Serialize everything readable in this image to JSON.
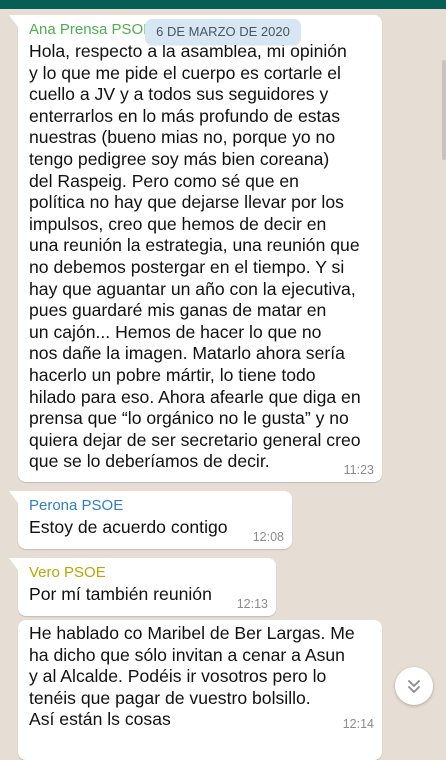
{
  "messages": [
    {
      "sender": "Ana Prensa PSOE",
      "sender_color": "#4caf50",
      "lines": [
        "Hola, respecto a la asamblea, mi opinión",
        "y lo que me pide el cuerpo es cortarle el",
        "cuello a JV y a todos sus seguidores y",
        "enterrarlos en lo más profundo de estas",
        "nuestras (bueno mias no, porque yo no",
        "tengo pedigree soy más bien coreana)",
        "del Raspeig. Pero como sé que en",
        "política no hay que dejarse llevar por los",
        "impulsos, creo que hemos de decir en",
        "una reunión la estrategia, una reunión que",
        "no debemos postergar en el tiempo. Y si",
        "hay que aguantar un año con la ejecutiva,",
        "pues guardaré mis ganas de matar en",
        "un cajón... Hemos de hacer lo que no",
        "nos dañe la imagen. Matarlo ahora sería",
        "hacerlo un pobre mártir, lo tiene todo",
        "hilado para eso. Ahora afearle que diga en",
        "prensa que “lo orgánico no le gusta” y no",
        "quiera dejar de ser secretario general creo",
        "que se lo deberíamos de decir."
      ],
      "time": "11:23"
    },
    {
      "sender": "Perona PSOE",
      "sender_color": "#2f7fc1",
      "lines": [
        "Estoy de acuerdo contigo"
      ],
      "time": "12:08"
    },
    {
      "sender": "Vero PSOE",
      "sender_color": "#b5a800",
      "lines": [
        "Por mí también reunión"
      ],
      "time": "12:13"
    },
    {
      "sender": "",
      "lines": [
        "He hablado co Maribel de Ber Largas. Me",
        "ha dicho que sólo invitan a cenar a Asun",
        "y al Alcalde. Podéis ir vosotros pero lo",
        "tenéis que pagar de vuestro bolsillo.",
        "Así están ls cosas"
      ],
      "time": "12:14"
    }
  ],
  "date_pill": "6 DE MARZO DE 2020",
  "scroll_button_icon": "double-chevron-down-icon"
}
